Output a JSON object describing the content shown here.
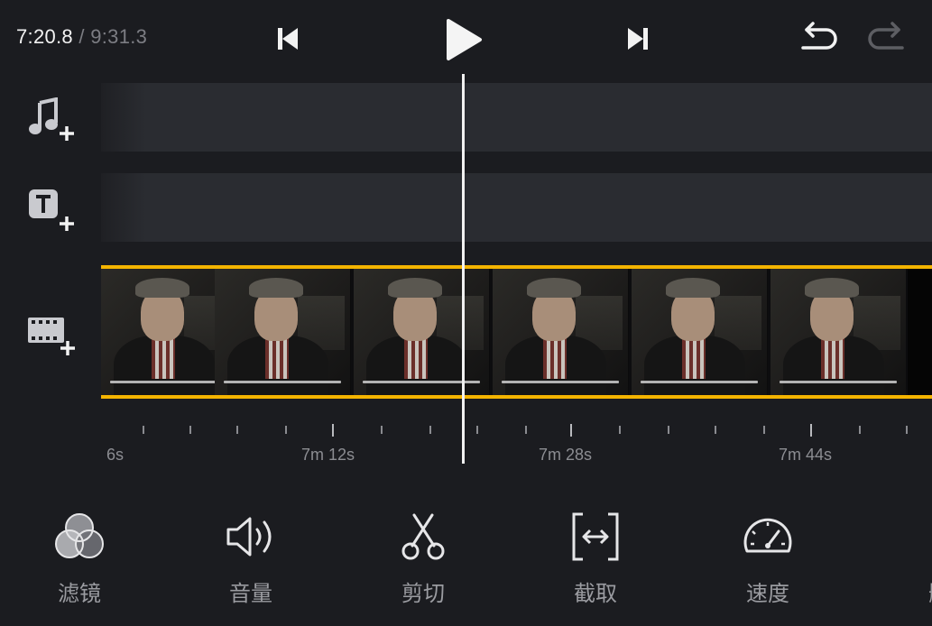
{
  "time": {
    "current": "7:20.8",
    "separator": "/",
    "total": "9:31.3"
  },
  "ruler": {
    "labels": [
      "6s",
      "7m 12s",
      "7m 28s",
      "7m 44s"
    ]
  },
  "toolbar": {
    "items": [
      {
        "id": "filter",
        "label": "滤镜",
        "icon": "filter-icon"
      },
      {
        "id": "volume",
        "label": "音量",
        "icon": "volume-icon"
      },
      {
        "id": "cut",
        "label": "剪切",
        "icon": "scissors-icon"
      },
      {
        "id": "trim",
        "label": "截取",
        "icon": "trim-icon"
      },
      {
        "id": "speed",
        "label": "速度",
        "icon": "speedometer-icon"
      },
      {
        "id": "delete",
        "label": "删",
        "icon": "trash-icon"
      }
    ]
  },
  "colors": {
    "accent": "#f4b400",
    "background": "#1b1c20",
    "track": "#2a2c31"
  },
  "icons": [
    "skip-back-icon",
    "play-icon",
    "skip-forward-icon",
    "undo-icon",
    "redo-icon",
    "add-music-icon",
    "add-text-icon",
    "add-clip-icon"
  ]
}
